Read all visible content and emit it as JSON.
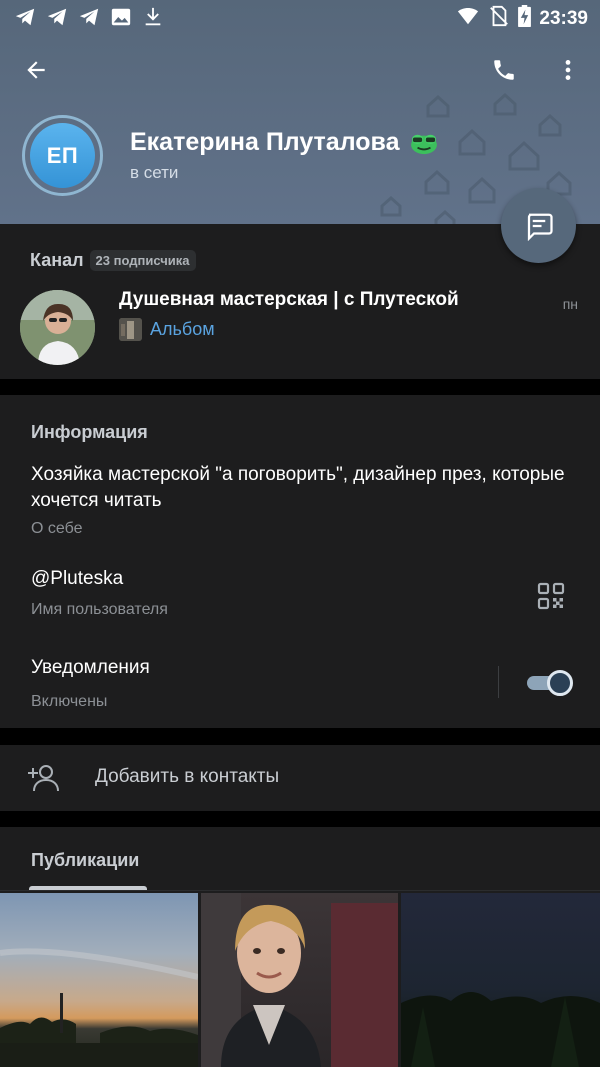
{
  "status_bar": {
    "time": "23:39",
    "left_icons": [
      "telegram-icon",
      "telegram-icon",
      "telegram-icon",
      "image-icon",
      "download-icon"
    ],
    "right_icons": [
      "wifi-icon",
      "no-sim-icon",
      "battery-charging-icon"
    ]
  },
  "header": {
    "avatar_initials": "ЕП",
    "name": "Екатерина Плуталова",
    "status": "в сети",
    "accent": "#3d9be3"
  },
  "channel": {
    "label": "Канал",
    "subscribers": "23 подписчика",
    "name": "Душевная мастерская | с Плутеской",
    "day": "пн",
    "last_message": "Альбом",
    "link_color": "#5aa3e0"
  },
  "info": {
    "heading": "Информация",
    "bio": "Хозяйка мастерской \"а поговорить\", дизайнер през, которые хочется читать",
    "bio_label": "О себе",
    "username": "@Pluteska",
    "username_label": "Имя пользователя",
    "notifications": "Уведомления",
    "notifications_state": "Включены",
    "notifications_on": true
  },
  "actions": {
    "add_contact": "Добавить в контакты"
  },
  "publications": {
    "heading": "Публикации"
  }
}
